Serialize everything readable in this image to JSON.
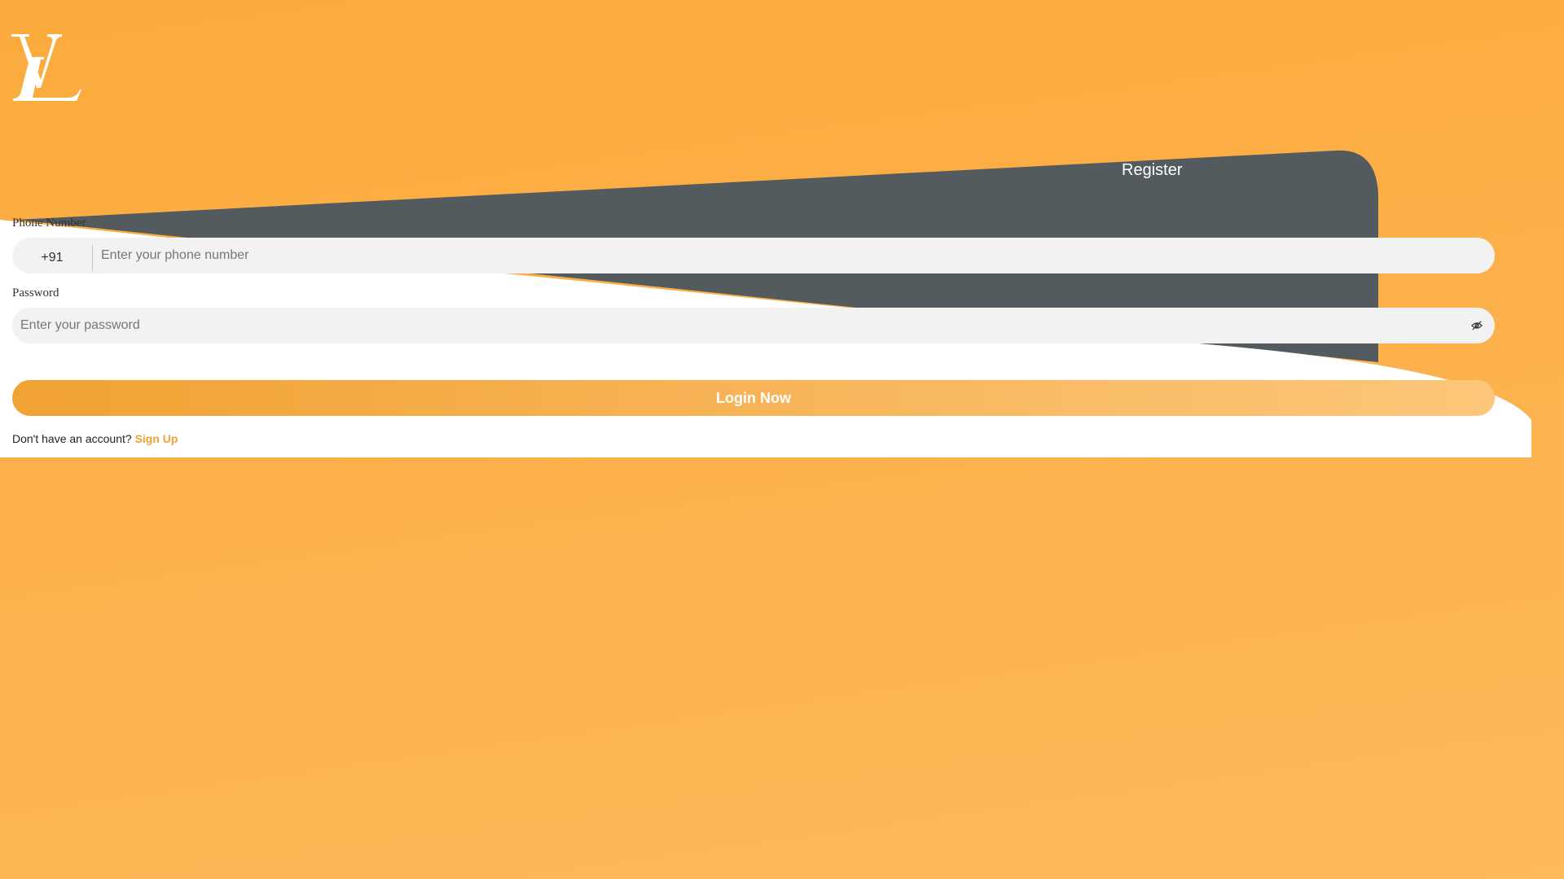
{
  "brand": {
    "logo_icon": "lv-monogram-icon",
    "accent_color": "#f0a232",
    "panel_color": "#545b5f"
  },
  "tabs": {
    "register_label": "Register"
  },
  "form": {
    "phone": {
      "label": "Phone Number",
      "country_code": "+91",
      "placeholder": "Enter your phone number",
      "value": ""
    },
    "password": {
      "label": "Password",
      "placeholder": "Enter your password",
      "value": "",
      "toggle_icon": "eye-slash-icon"
    },
    "submit_label": "Login Now",
    "signup_prompt": "Don't have an account?",
    "signup_link": "Sign Up"
  }
}
